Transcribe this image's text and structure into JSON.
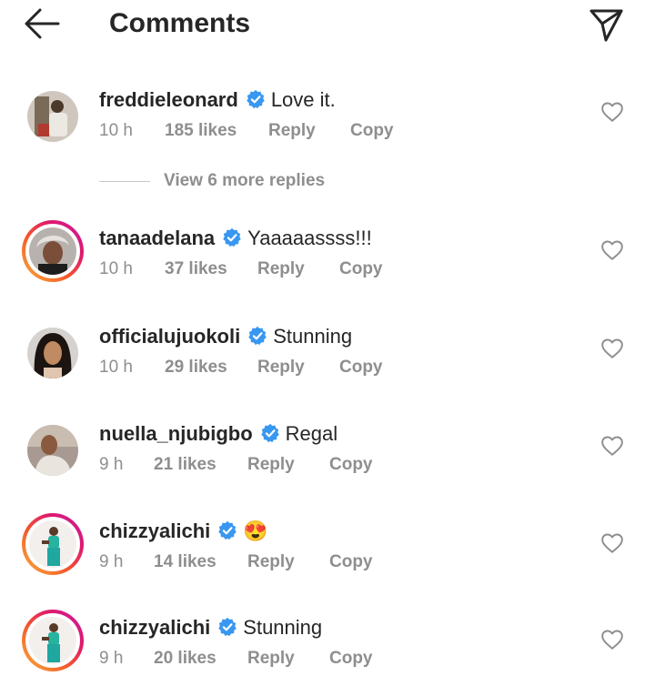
{
  "header": {
    "title": "Comments",
    "back_icon": "arrow-left-icon",
    "send_icon": "paper-plane-icon"
  },
  "colors": {
    "text": "#262626",
    "secondary": "#8e8e8e",
    "verified": "#3897f0"
  },
  "comments": [
    {
      "username": "freddieleonard",
      "text": "Love it.",
      "time": "10 h",
      "likes": "185 likes",
      "reply": "Reply",
      "copy": "Copy",
      "story_ring": false
    },
    {
      "username": "tanaadelana",
      "text": "Yaaaaassss!!!",
      "time": "10 h",
      "likes": "37 likes",
      "reply": "Reply",
      "copy": "Copy",
      "story_ring": true
    },
    {
      "username": "officialujuokoli",
      "text": "Stunning",
      "time": "10 h",
      "likes": "29 likes",
      "reply": "Reply",
      "copy": "Copy",
      "story_ring": false
    },
    {
      "username": "nuella_njubigbo",
      "text": "Regal",
      "time": "9 h",
      "likes": "21 likes",
      "reply": "Reply",
      "copy": "Copy",
      "story_ring": false
    },
    {
      "username": "chizzyalichi",
      "text": "😍",
      "time": "9 h",
      "likes": "14 likes",
      "reply": "Reply",
      "copy": "Copy",
      "story_ring": true
    },
    {
      "username": "chizzyalichi",
      "text": "Stunning",
      "time": "9 h",
      "likes": "20 likes",
      "reply": "Reply",
      "copy": "Copy",
      "story_ring": true
    }
  ],
  "view_replies": "View 6 more replies"
}
